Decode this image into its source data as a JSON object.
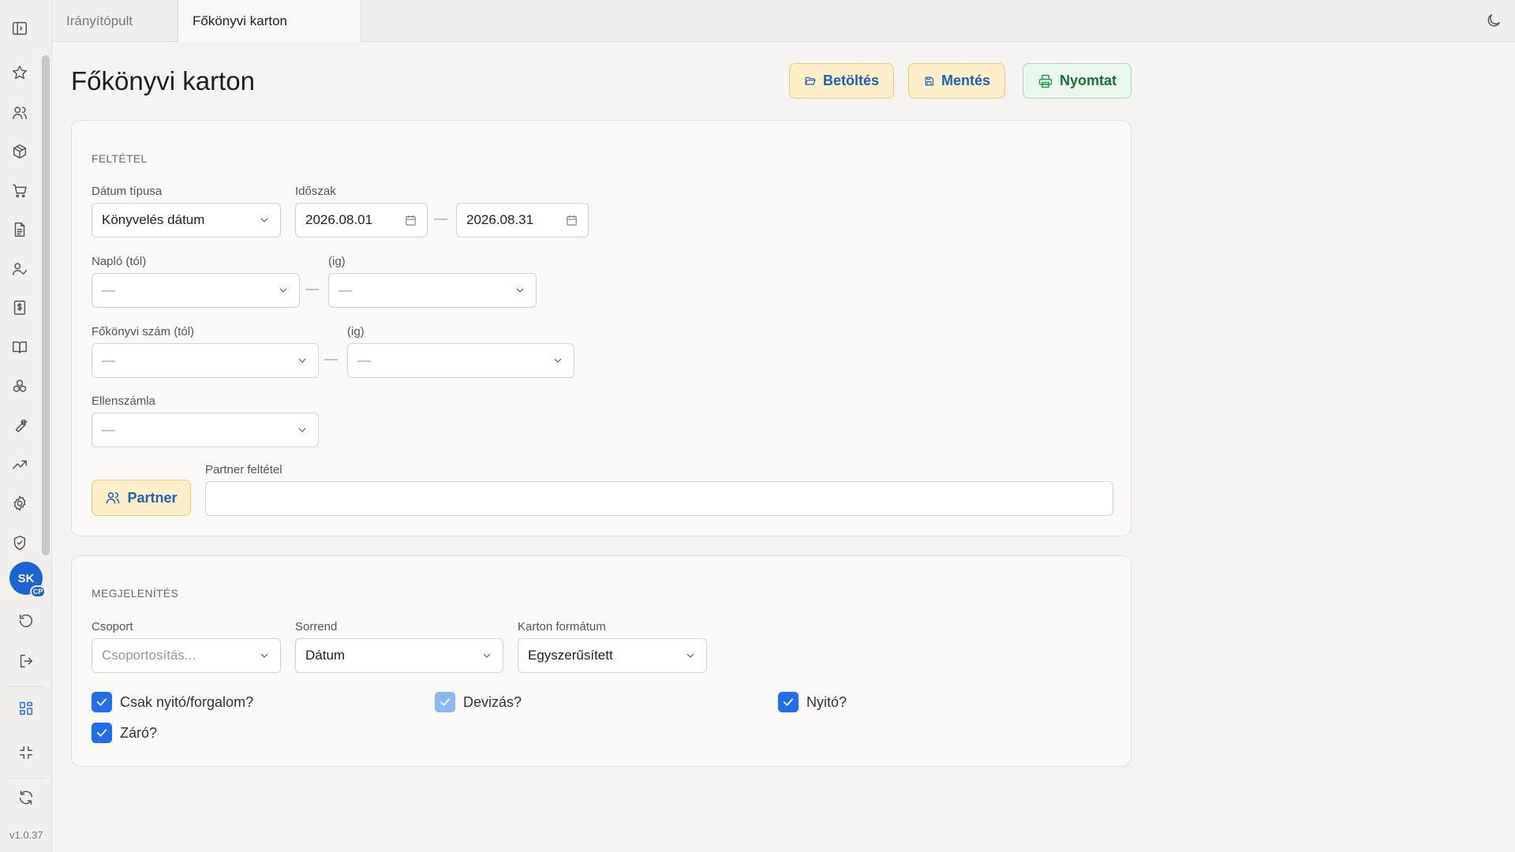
{
  "sidebar": {
    "version": "v1.0.37",
    "avatar_initials": "SK",
    "avatar_badge": "CP",
    "accent": "#1e63d6"
  },
  "tabs": [
    {
      "label": "Irányítópult",
      "active": false
    },
    {
      "label": "Főkönyvi karton",
      "active": true
    }
  ],
  "header": {
    "title": "Főkönyvi karton",
    "load_label": "Betöltés",
    "save_label": "Mentés",
    "print_label": "Nyomtat"
  },
  "filter": {
    "section_title": "FELTÉTEL",
    "date_type_label": "Dátum típusa",
    "date_type_value": "Könyvelés dátum",
    "period_label": "Időszak",
    "period_from": "2026.08.01",
    "period_to": "2026.08.31",
    "journal_from_label": "Napló (tól)",
    "journal_to_label": "(ig)",
    "journal_from_value": "—",
    "journal_to_value": "—",
    "account_from_label": "Főkönyvi szám (tól)",
    "account_to_label": "(ig)",
    "account_from_value": "—",
    "account_to_value": "—",
    "counter_label": "Ellenszámla",
    "counter_value": "—",
    "partner_button": "Partner",
    "partner_filter_label": "Partner feltétel",
    "partner_filter_value": ""
  },
  "display": {
    "section_title": "MEGJELENÍTÉS",
    "group_label": "Csoport",
    "group_placeholder": "Csoportosítás...",
    "order_label": "Sorrend",
    "order_value": "Dátum",
    "format_label": "Karton formátum",
    "format_value": "Egyszerűsített",
    "checkboxes": [
      {
        "label": "Csak nyitó/forgalom?",
        "checked": true
      },
      {
        "label": "Devizás?",
        "checked": true,
        "disabled": true
      },
      {
        "label": "Nyitó?",
        "checked": true
      },
      {
        "label": "Záró?",
        "checked": true
      }
    ]
  }
}
